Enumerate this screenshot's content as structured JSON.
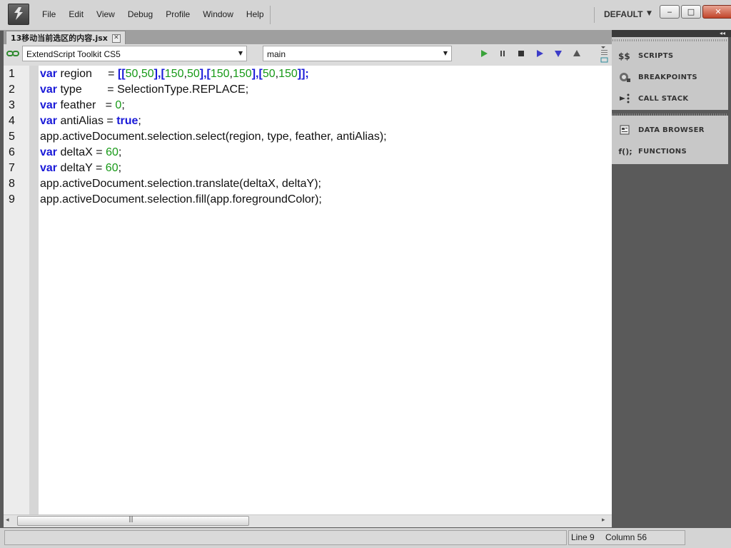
{
  "app": {
    "menu": [
      "File",
      "Edit",
      "View",
      "Debug",
      "Profile",
      "Window",
      "Help"
    ],
    "workspace": "DEFAULT"
  },
  "window_buttons": {
    "minimize": "‒",
    "maximize": "□",
    "close": "✕"
  },
  "tab": {
    "title": "13移动当前选区的内容.jsx",
    "close": "✕"
  },
  "toolbar": {
    "target_app": "ExtendScript Toolkit CS5",
    "engine": "main",
    "buttons": [
      "run",
      "pause",
      "stop",
      "step-over",
      "step-into",
      "step-out"
    ]
  },
  "editor": {
    "lines": [
      {
        "n": "1",
        "tokens": [
          {
            "t": "var",
            "c": "kw"
          },
          {
            "t": " region     = ",
            "c": ""
          },
          {
            "t": "[[",
            "c": "kw"
          },
          {
            "t": "50",
            "c": "num"
          },
          {
            "t": ",",
            "c": ""
          },
          {
            "t": "50",
            "c": "num"
          },
          {
            "t": "],[",
            "c": "kw"
          },
          {
            "t": "150",
            "c": "num"
          },
          {
            "t": ",",
            "c": ""
          },
          {
            "t": "50",
            "c": "num"
          },
          {
            "t": "],[",
            "c": "kw"
          },
          {
            "t": "150",
            "c": "num"
          },
          {
            "t": ",",
            "c": ""
          },
          {
            "t": "150",
            "c": "num"
          },
          {
            "t": "],[",
            "c": "kw"
          },
          {
            "t": "50",
            "c": "num"
          },
          {
            "t": ",",
            "c": ""
          },
          {
            "t": "150",
            "c": "num"
          },
          {
            "t": "]];",
            "c": "kw"
          }
        ]
      },
      {
        "n": "2",
        "tokens": [
          {
            "t": "var",
            "c": "kw"
          },
          {
            "t": " type        = SelectionType.REPLACE;",
            "c": ""
          }
        ]
      },
      {
        "n": "3",
        "tokens": [
          {
            "t": "var",
            "c": "kw"
          },
          {
            "t": " feather   = ",
            "c": ""
          },
          {
            "t": "0",
            "c": "num"
          },
          {
            "t": ";",
            "c": ""
          }
        ]
      },
      {
        "n": "4",
        "tokens": [
          {
            "t": "var",
            "c": "kw"
          },
          {
            "t": " antiAlias = ",
            "c": ""
          },
          {
            "t": "true",
            "c": "kw"
          },
          {
            "t": ";",
            "c": ""
          }
        ]
      },
      {
        "n": "5",
        "tokens": [
          {
            "t": "app.activeDocument.selection.select(region, type, feather, antiAlias);",
            "c": ""
          }
        ]
      },
      {
        "n": "6",
        "tokens": [
          {
            "t": "var",
            "c": "kw"
          },
          {
            "t": " deltaX = ",
            "c": ""
          },
          {
            "t": "60",
            "c": "num"
          },
          {
            "t": ";",
            "c": ""
          }
        ]
      },
      {
        "n": "7",
        "tokens": [
          {
            "t": "var",
            "c": "kw"
          },
          {
            "t": " deltaY = ",
            "c": ""
          },
          {
            "t": "60",
            "c": "num"
          },
          {
            "t": ";",
            "c": ""
          }
        ]
      },
      {
        "n": "8",
        "tokens": [
          {
            "t": "app.activeDocument.selection.translate(deltaX, deltaY);",
            "c": ""
          }
        ]
      },
      {
        "n": "9",
        "tokens": [
          {
            "t": "app.activeDocument.selection.fill(app.foregroundColor);",
            "c": ""
          }
        ]
      }
    ]
  },
  "scrollbar": {
    "left": "◂",
    "right": "▸",
    "grip": "|||"
  },
  "status": {
    "line": "Line 9",
    "column": "Column 56"
  },
  "panels": {
    "scripts": {
      "label": "SCRIPTS",
      "icon": "scripts-icon"
    },
    "breakpoints": {
      "label": "BREAKPOINTS",
      "icon": "breakpoints-icon"
    },
    "call_stack": {
      "label": "CALL STACK",
      "icon": "call-stack-icon"
    },
    "data_browser": {
      "label": "DATA BROWSER",
      "icon": "data-browser-icon"
    },
    "functions": {
      "label": "FUNCTIONS",
      "icon": "functions-icon",
      "glyph": "f();"
    }
  },
  "colors": {
    "keyword": "#1a1ad8",
    "number": "#189a18",
    "panel_bg": "#5a5a5a"
  }
}
